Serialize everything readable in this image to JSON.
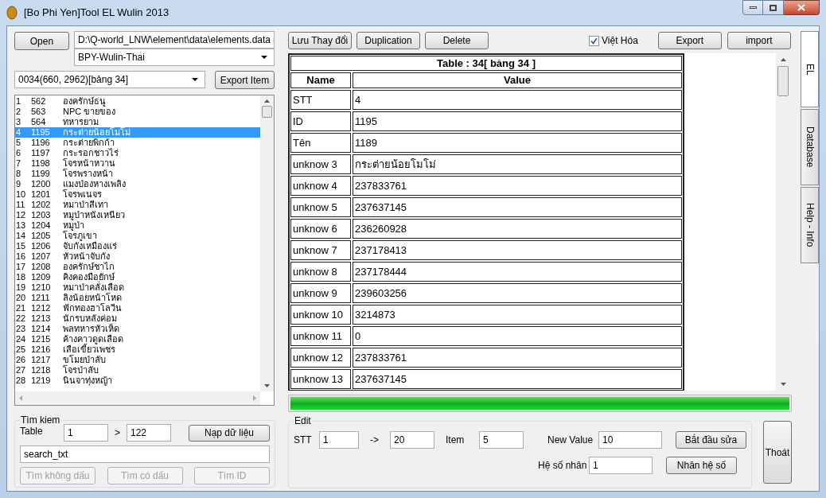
{
  "window": {
    "title": "[Bo Phi Yen]Tool EL Wulin 2013"
  },
  "file": {
    "open_button": "Open",
    "path": "D:\\Q-world_LNW\\element\\data\\elements.data",
    "profile": "BPY-Wulin-Thai"
  },
  "table_select": {
    "value": "0034(660, 2962)[bảng 34]",
    "export_button": "Export Item"
  },
  "items": [
    {
      "no": "1",
      "id": "562",
      "name": "องครักษ์ธนู",
      "selected": false
    },
    {
      "no": "2",
      "id": "563",
      "name": "NPC ขายของ",
      "selected": false
    },
    {
      "no": "3",
      "id": "564",
      "name": "ทหารยาม",
      "selected": false
    },
    {
      "no": "4",
      "id": "1195",
      "name": "กระต่ายน้อยโมโม่",
      "selected": true
    },
    {
      "no": "5",
      "id": "1196",
      "name": "กระต่ายพิกก้า",
      "selected": false
    },
    {
      "no": "6",
      "id": "1197",
      "name": "กระรอกชาวไร่",
      "selected": false
    },
    {
      "no": "7",
      "id": "1198",
      "name": "โจรหน้าหวาน",
      "selected": false
    },
    {
      "no": "8",
      "id": "1199",
      "name": "โจรพรางหน้า",
      "selected": false
    },
    {
      "no": "9",
      "id": "1200",
      "name": "แมงป่องหางเพลิง",
      "selected": false
    },
    {
      "no": "10",
      "id": "1201",
      "name": "โจรพเนจร",
      "selected": false
    },
    {
      "no": "11",
      "id": "1202",
      "name": "หมาป่าสีเทา",
      "selected": false
    },
    {
      "no": "12",
      "id": "1203",
      "name": "หมูป่าหนังเหนียว",
      "selected": false
    },
    {
      "no": "13",
      "id": "1204",
      "name": "หมูป่า",
      "selected": false
    },
    {
      "no": "14",
      "id": "1205",
      "name": "โจรภูเขา",
      "selected": false
    },
    {
      "no": "15",
      "id": "1206",
      "name": "จับกังเหมืองแร่",
      "selected": false
    },
    {
      "no": "16",
      "id": "1207",
      "name": "หัวหน้าจับกัง",
      "selected": false
    },
    {
      "no": "17",
      "id": "1208",
      "name": "องครักษ์ชาไก",
      "selected": false
    },
    {
      "no": "18",
      "id": "1209",
      "name": "คิงคองมือยักษ์",
      "selected": false
    },
    {
      "no": "19",
      "id": "1210",
      "name": "หมาป่าคลั่งเลือด",
      "selected": false
    },
    {
      "no": "20",
      "id": "1211",
      "name": "ลิงน้อยหน้าโหด",
      "selected": false
    },
    {
      "no": "21",
      "id": "1212",
      "name": "ฟักทองฮาโลวีน",
      "selected": false
    },
    {
      "no": "22",
      "id": "1213",
      "name": "นักรบหลังค่อม",
      "selected": false
    },
    {
      "no": "23",
      "id": "1214",
      "name": "พลทหารหัวเห็ด",
      "selected": false
    },
    {
      "no": "24",
      "id": "1215",
      "name": "ค้างคาวดูดเลือด",
      "selected": false
    },
    {
      "no": "25",
      "id": "1216",
      "name": "เสือเขี้ยวเพชร",
      "selected": false
    },
    {
      "no": "26",
      "id": "1217",
      "name": "ขโมยป่าลับ",
      "selected": false
    },
    {
      "no": "27",
      "id": "1218",
      "name": "โจรป่าลับ",
      "selected": false
    },
    {
      "no": "28",
      "id": "1219",
      "name": "นินจาทุ่งหญ้า",
      "selected": false
    }
  ],
  "search": {
    "title": "Tìm kiem",
    "table_label": "Table",
    "from": "1",
    "sep": ">",
    "to": "122",
    "load_button": "Nạp dữ liệu",
    "query": "search_txt",
    "buttons": [
      {
        "label": "Tìm không dấu",
        "disabled": true
      },
      {
        "label": "Tìm có dấu",
        "disabled": true
      },
      {
        "label": "Tìm ID",
        "disabled": true
      }
    ]
  },
  "toolbar": {
    "buttons": [
      "Lưu Thay đổi",
      "Duplication",
      "Delete"
    ],
    "viet_hoa": {
      "label": "Việt Hóa",
      "checked": true
    },
    "export": "Export",
    "import": "import"
  },
  "table": {
    "title": "Table : 34[ bảng 34 ]",
    "columns": [
      "Name",
      "Value"
    ],
    "rows": [
      [
        "STT",
        "4"
      ],
      [
        "ID",
        "1195"
      ],
      [
        "Tên",
        "1189"
      ],
      [
        "unknow 3",
        "กระต่ายน้อยโมโม่"
      ],
      [
        "unknow 4",
        "237833761"
      ],
      [
        "unknow 5",
        "237637145"
      ],
      [
        "unknow 6",
        "236260928"
      ],
      [
        "unknow 7",
        "237178413"
      ],
      [
        "unknow 8",
        "237178444"
      ],
      [
        "unknow 9",
        "239603256"
      ],
      [
        "unknow 10",
        "3214873"
      ],
      [
        "unknow 11",
        "0"
      ],
      [
        "unknow 12",
        "237833761"
      ],
      [
        "unknow 13",
        "237637145"
      ]
    ]
  },
  "progress": {
    "level": 1
  },
  "edit": {
    "title": "Edit",
    "stt_label": "STT",
    "stt_from": "1",
    "arrow": "->",
    "stt_to": "20",
    "item_label": "Item",
    "item": "5",
    "new_value_label": "New Value",
    "new_value": "10",
    "start_button": "Bắt đầu sửa",
    "factor_label": "Hệ số nhân",
    "factor": "1",
    "factor_button": "Nhân hệ số"
  },
  "exit_button": "Thoát",
  "side_tabs": [
    {
      "label": "EL",
      "selected": true
    },
    {
      "label": "Database",
      "selected": false
    },
    {
      "label": "Help - Info",
      "selected": false
    }
  ]
}
